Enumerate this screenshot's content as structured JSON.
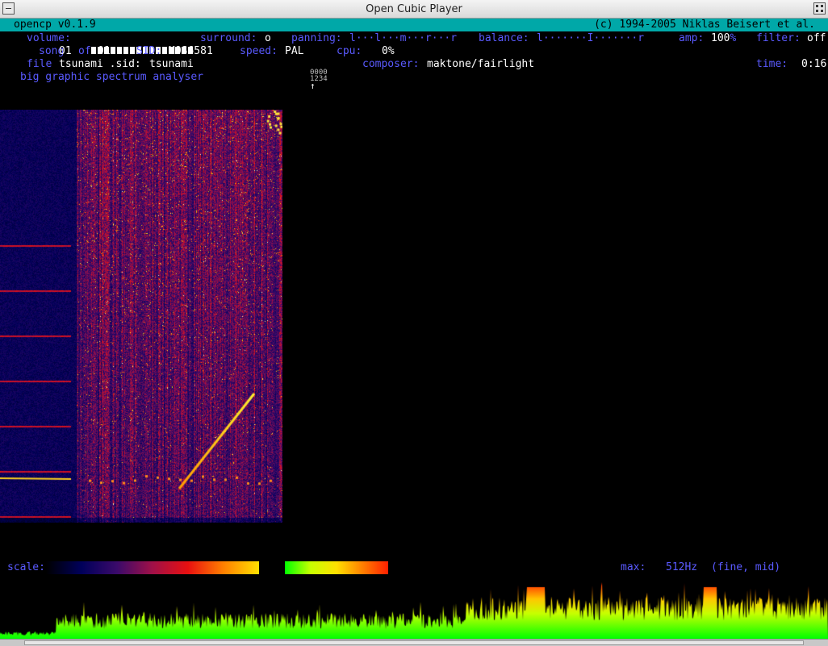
{
  "window": {
    "title": "Open Cubic Player"
  },
  "header": {
    "left": "opencp v0.1.9",
    "right": "(c) 1994-2005 Niklas Beisert et al."
  },
  "status": {
    "volume_label": "volume:",
    "volume_level": 1.0,
    "surround_label": "surround:",
    "surround_value": "o",
    "panning_label": "panning:",
    "panning_value": "l···l···m···r···r",
    "balance_label": "balance:",
    "balance_value": "l·······I·······r",
    "amp_label": "amp:",
    "amp_value": "100",
    "amp_unit": "%",
    "filter_label": "filter:",
    "filter_value": "off",
    "song_label": "song",
    "song_current": "01",
    "song_of": "of",
    "song_total": "01",
    "sid_label": "SID:",
    "sid_value": "MOS6581",
    "speed_label": "speed:",
    "speed_value": "PAL",
    "cpu_label": "cpu:",
    "cpu_value": "0%",
    "file_label": "file",
    "file_value": "tsunami .sid:",
    "file_title": "tsunami",
    "composer_label": "composer:",
    "composer_value": "maktone/fairlight",
    "time_label": "time:",
    "time_value": "0:16"
  },
  "mode_title": "big graphic spectrum analyser",
  "channels": {
    "row1": "0000",
    "row2": "1234",
    "marker": "↑"
  },
  "scale_label": "scale:",
  "max_label": "max:",
  "max_value": "512Hz",
  "max_mode": "(fine, mid)",
  "colors": {
    "header_bg": "#00a8a8",
    "label": "#5a5aff",
    "value": "#ffffff",
    "scale_a": [
      "#000000",
      "#00005a",
      "#3a0a6a",
      "#a01048",
      "#e81010",
      "#ff8000",
      "#ffe000"
    ],
    "scale_b": [
      "#00ff00",
      "#c8ff00",
      "#ffe000",
      "#ff8000",
      "#ff2000"
    ]
  }
}
